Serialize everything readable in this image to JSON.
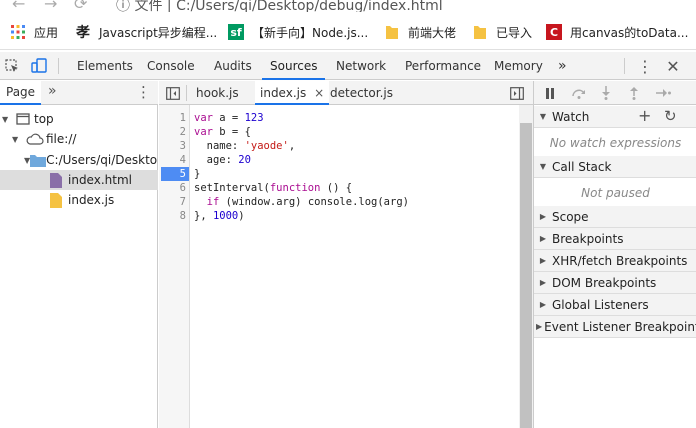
{
  "address_bar": {
    "url": "C:/Users/qi/Desktop/debug/index.html",
    "security_label": "文件"
  },
  "bookmarks": [
    {
      "label": "应用",
      "icon": "apps-grid-icon",
      "color": "#1a73e8"
    },
    {
      "label": "Javascript异步编程...",
      "icon": "site-logo-icon",
      "color": "#333333"
    },
    {
      "label": "【新手向】Node.js...",
      "icon": "sf-icon",
      "color": "#009a61"
    },
    {
      "label": "前端大佬",
      "icon": "folder-icon",
      "color": "#f5c242"
    },
    {
      "label": "已导入",
      "icon": "folder-icon",
      "color": "#f5c242"
    },
    {
      "label": "用canvas的toData...",
      "icon": "c-logo-icon",
      "color": "#c7161e"
    }
  ],
  "devtools": {
    "tabs": [
      "Elements",
      "Console",
      "Audits",
      "Sources",
      "Network",
      "Performance",
      "Memory"
    ],
    "active_tab": "Sources",
    "more_glyph": "»"
  },
  "navigator": {
    "tab": "Page",
    "tree": [
      {
        "label": "top",
        "icon": "frame-icon"
      },
      {
        "label": "file://",
        "icon": "cloud-icon"
      },
      {
        "label": "C:/Users/qi/Desktop/debug",
        "icon": "folder-icon"
      },
      {
        "label": "index.html",
        "icon": "html-file-icon"
      },
      {
        "label": "index.js",
        "icon": "js-file-icon"
      }
    ]
  },
  "editor": {
    "tabs": [
      "hook.js",
      "index.js",
      "detector.js"
    ],
    "active_tab": "index.js",
    "close_glyph": "×",
    "breakpoint_line": 5,
    "lines": [
      [
        {
          "t": "kw",
          "v": "var"
        },
        {
          "t": "pl",
          "v": " a = "
        },
        {
          "t": "num",
          "v": "123"
        }
      ],
      [
        {
          "t": "kw",
          "v": "var"
        },
        {
          "t": "pl",
          "v": " b = {"
        }
      ],
      [
        {
          "t": "pl",
          "v": "  name: "
        },
        {
          "t": "str",
          "v": "'yaode'"
        },
        {
          "t": "pl",
          "v": ","
        }
      ],
      [
        {
          "t": "pl",
          "v": "  age: "
        },
        {
          "t": "num",
          "v": "20"
        }
      ],
      [
        {
          "t": "pl",
          "v": "}"
        }
      ],
      [
        {
          "t": "pl",
          "v": "setInterval("
        },
        {
          "t": "kw",
          "v": "function"
        },
        {
          "t": "pl",
          "v": " () {"
        }
      ],
      [
        {
          "t": "pl",
          "v": "  "
        },
        {
          "t": "kw",
          "v": "if"
        },
        {
          "t": "pl",
          "v": " (window.arg) console.log(arg)"
        }
      ],
      [
        {
          "t": "pl",
          "v": "}, "
        },
        {
          "t": "num",
          "v": "1000"
        },
        {
          "t": "pl",
          "v": ")"
        }
      ]
    ]
  },
  "debugger": {
    "watch": {
      "title": "Watch",
      "empty": "No watch expressions"
    },
    "call_stack": {
      "title": "Call Stack",
      "empty": "Not paused"
    },
    "sections": [
      "Scope",
      "Breakpoints",
      "XHR/fetch Breakpoints",
      "DOM Breakpoints",
      "Global Listeners",
      "Event Listener Breakpoints"
    ]
  }
}
